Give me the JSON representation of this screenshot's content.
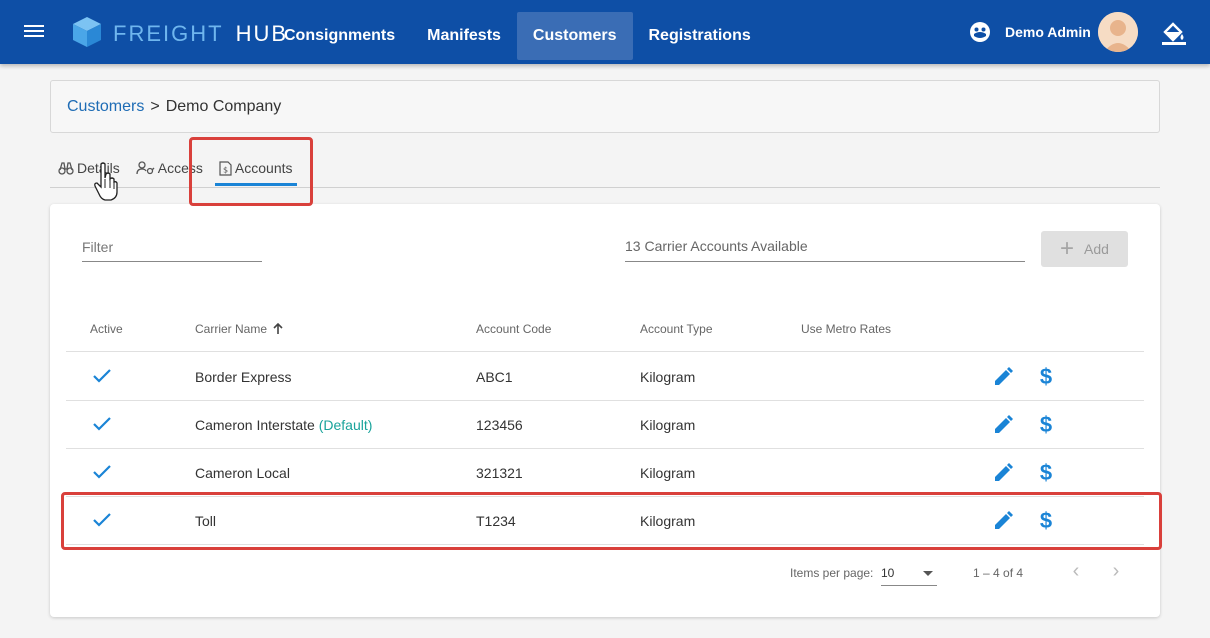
{
  "app": {
    "brand_part1": "FREIGHT",
    "brand_part2": "HUB",
    "nav": [
      "Consignments",
      "Manifests",
      "Customers",
      "Registrations"
    ],
    "active_nav": "Customers",
    "user_name": "Demo Admin"
  },
  "breadcrumb": {
    "root": "Customers",
    "separator": ">",
    "current": "Demo Company"
  },
  "tabs": [
    {
      "label": "Details",
      "icon": "binoculars-icon"
    },
    {
      "label": "Access",
      "icon": "user-key-icon"
    },
    {
      "label": "Accounts",
      "icon": "dollar-document-icon"
    }
  ],
  "active_tab": "Accounts",
  "filter": {
    "placeholder": "Filter",
    "value": ""
  },
  "carrier_select": {
    "placeholder": "13 Carrier Accounts Available"
  },
  "add_button": {
    "label": "Add",
    "icon": "plus-icon",
    "enabled": false
  },
  "table": {
    "columns": [
      "Active",
      "Carrier Name",
      "Account Code",
      "Account Type",
      "Use Metro Rates"
    ],
    "sort_column": "Carrier Name",
    "sort_direction": "ascending",
    "rows": [
      {
        "active": true,
        "carrier": "Border Express",
        "default_tag": "",
        "code": "ABC1",
        "type": "Kilogram",
        "metro": ""
      },
      {
        "active": true,
        "carrier": "Cameron Interstate",
        "default_tag": "(Default)",
        "code": "123456",
        "type": "Kilogram",
        "metro": ""
      },
      {
        "active": true,
        "carrier": "Cameron Local",
        "default_tag": "",
        "code": "321321",
        "type": "Kilogram",
        "metro": ""
      },
      {
        "active": true,
        "carrier": "Toll",
        "default_tag": "",
        "code": "T1234",
        "type": "Kilogram",
        "metro": ""
      }
    ]
  },
  "paginator": {
    "items_per_page_label": "Items per page:",
    "page_size": "10",
    "range": "1 – 4 of 4",
    "prev": "‹",
    "next": "›"
  },
  "colors": {
    "topbar": "#0e4fa6",
    "accent": "#1a84d6",
    "highlight": "#d9403b",
    "default_tag": "#19a39b"
  }
}
